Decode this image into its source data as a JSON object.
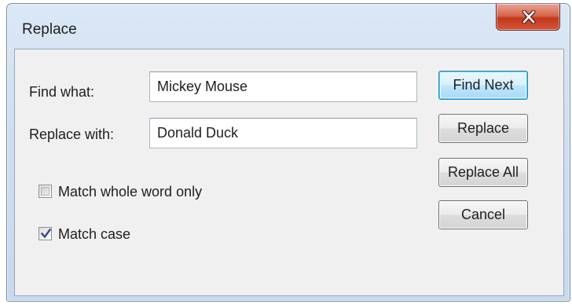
{
  "dialog": {
    "title": "Replace"
  },
  "form": {
    "find_label": "Find what:",
    "find_value": "Mickey Mouse",
    "replace_label": "Replace with:",
    "replace_value": "Donald Duck"
  },
  "options": {
    "whole_word_label": "Match whole word only",
    "whole_word_checked": false,
    "match_case_label": "Match case",
    "match_case_checked": true
  },
  "buttons": {
    "find_next": "Find Next",
    "replace": "Replace",
    "replace_all": "Replace All",
    "cancel": "Cancel"
  },
  "icons": {
    "close": "close-icon",
    "check": "checkmark-icon"
  },
  "colors": {
    "title_bar": "#cfdff0",
    "close_button": "#c7452a",
    "default_button_border": "#3c7fb1",
    "check_mark": "#2d4b8c"
  }
}
